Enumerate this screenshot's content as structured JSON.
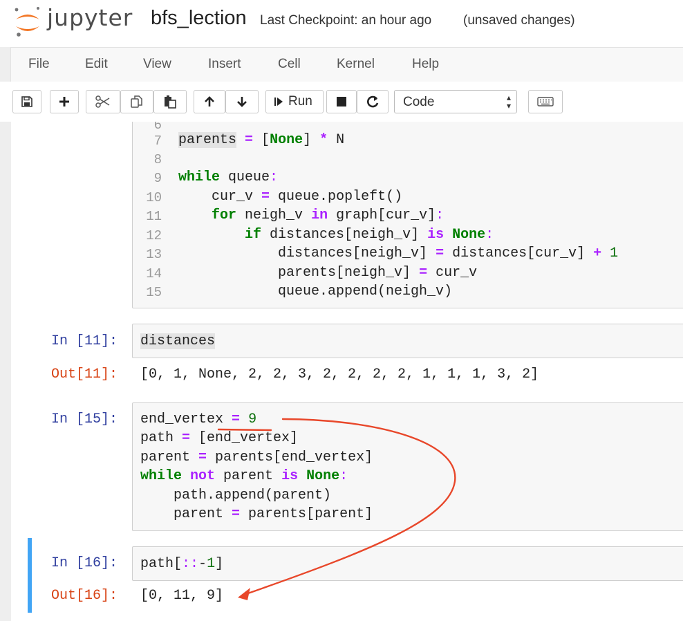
{
  "app": {
    "brand": "jupyter",
    "notebook_name": "bfs_lection",
    "checkpoint": "Last Checkpoint: an hour ago",
    "unsaved": "(unsaved changes)"
  },
  "menu": [
    "File",
    "Edit",
    "View",
    "Insert",
    "Cell",
    "Kernel",
    "Help"
  ],
  "toolbar": {
    "run_label": "Run",
    "cell_type": "Code",
    "icons": [
      "save-icon",
      "plus-icon",
      "cut-icon",
      "copy-icon",
      "paste-icon",
      "arrow-up-icon",
      "arrow-down-icon",
      "run-icon",
      "stop-icon",
      "restart-icon",
      "keyboard-icon"
    ]
  },
  "cell_top": {
    "partial_line_number": "6",
    "lines": [
      {
        "n": "7",
        "t": "parents = [None] * N"
      },
      {
        "n": "8",
        "t": ""
      },
      {
        "n": "9",
        "t": "while queue:"
      },
      {
        "n": "10",
        "t": "    cur_v = queue.popleft()"
      },
      {
        "n": "11",
        "t": "    for neigh_v in graph[cur_v]:"
      },
      {
        "n": "12",
        "t": "        if distances[neigh_v] is None:"
      },
      {
        "n": "13",
        "t": "            distances[neigh_v] = distances[cur_v] + 1"
      },
      {
        "n": "14",
        "t": "            parents[neigh_v] = cur_v"
      },
      {
        "n": "15",
        "t": "            queue.append(neigh_v)"
      }
    ]
  },
  "cell11": {
    "in_prompt": "In [11]:",
    "code": "distances",
    "out_prompt": "Out[11]:",
    "output": "[0, 1, None, 2, 2, 3, 2, 2, 2, 2, 1, 1, 1, 3, 2]"
  },
  "cell15": {
    "in_prompt": "In [15]:",
    "lines": [
      "end_vertex = 9",
      "path = [end_vertex]",
      "parent = parents[end_vertex]",
      "while not parent is None:",
      "    path.append(parent)",
      "    parent = parents[parent]"
    ]
  },
  "cell16": {
    "in_prompt": "In [16]:",
    "code": "path[::-1]",
    "out_prompt": "Out[16]:",
    "output": "[0, 11, 9]"
  },
  "annotation_color": "#e8472a",
  "accent_color": "#42a5f5"
}
